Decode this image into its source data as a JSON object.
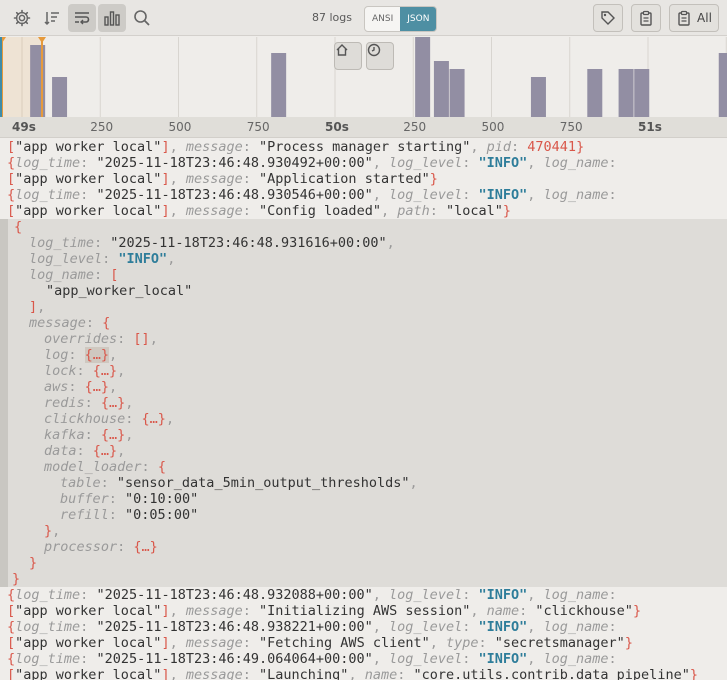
{
  "toolbar": {
    "log_count": "87 logs",
    "mode_ansi": "ANSI",
    "mode_json": "JSON",
    "all_label": "All"
  },
  "chart_data": {
    "type": "bar",
    "title": "",
    "xlabel": "",
    "ylabel": "",
    "x_tick_labels": [
      "49s",
      "250",
      "500",
      "750",
      "50s",
      "250",
      "500",
      "750",
      "51s"
    ],
    "bins": [
      {
        "t": "49.05",
        "count": 9
      },
      {
        "t": "49.12",
        "count": 5
      },
      {
        "t": "49.82",
        "count": 8
      },
      {
        "t": "50.28",
        "count": 10
      },
      {
        "t": "50.34",
        "count": 7
      },
      {
        "t": "50.39",
        "count": 6
      },
      {
        "t": "50.65",
        "count": 5
      },
      {
        "t": "50.83",
        "count": 6
      },
      {
        "t": "50.93",
        "count": 6
      },
      {
        "t": "50.98",
        "count": 6
      },
      {
        "t": "51.25",
        "count": 8
      }
    ],
    "color": "#928ea3",
    "grid": true
  },
  "logs": {
    "l1a": "[",
    "l1b": "\"app worker local\"",
    "l1c": "], ",
    "l1d": "message",
    "l1e": ": ",
    "l1f": "\"Process manager starting\"",
    "l1g": ", ",
    "l1h": "pid",
    "l1i": ": ",
    "l1j": "470441",
    "l1k": "}",
    "l2_time": "\"2025-11-18T23:46:48.930492+00:00\"",
    "l3_msg": "\"Application started\"",
    "l4_time": "\"2025-11-18T23:46:48.930546+00:00\"",
    "l5_msg": "\"Config loaded\"",
    "l5_path": "\"local\"",
    "e_time": "\"2025-11-18T23:46:48.931616+00:00\"",
    "e_level": "\"INFO\"",
    "e_name": "\"app_worker_local\"",
    "e_table": "\"sensor_data_5min_output_thresholds\"",
    "e_buffer": "\"0:10:00\"",
    "e_refill": "\"0:05:00\"",
    "l6_time": "\"2025-11-18T23:46:48.932088+00:00\"",
    "l7_msg": "\"Initializing AWS session\"",
    "l7_name": "\"clickhouse\"",
    "l8_time": "\"2025-11-18T23:46:48.938221+00:00\"",
    "l9_msg": "\"Fetching AWS client\"",
    "l9_type": "\"secretsmanager\"",
    "l10_time": "\"2025-11-18T23:46:49.064064+00:00\"",
    "l11_msg": "\"Launching\"",
    "l11_name": "\"core.utils.contrib.data_pipeline\"",
    "worker": "\"app worker local\"",
    "info": "\"INFO\"",
    "collapsed": "{…}",
    "empty_arr": "[]"
  },
  "keys": {
    "log_time": "log_time",
    "log_level": "log_level",
    "log_name": "log_name",
    "message": "message",
    "path": "path",
    "name": "name",
    "type": "type",
    "overrides": "overrides",
    "log": "log",
    "lock": "lock",
    "aws": "aws",
    "redis": "redis",
    "clickhouse": "clickhouse",
    "kafka": "kafka",
    "data": "data",
    "model_loader": "model_loader",
    "table": "table",
    "buffer": "buffer",
    "refill": "refill",
    "processor": "processor"
  }
}
